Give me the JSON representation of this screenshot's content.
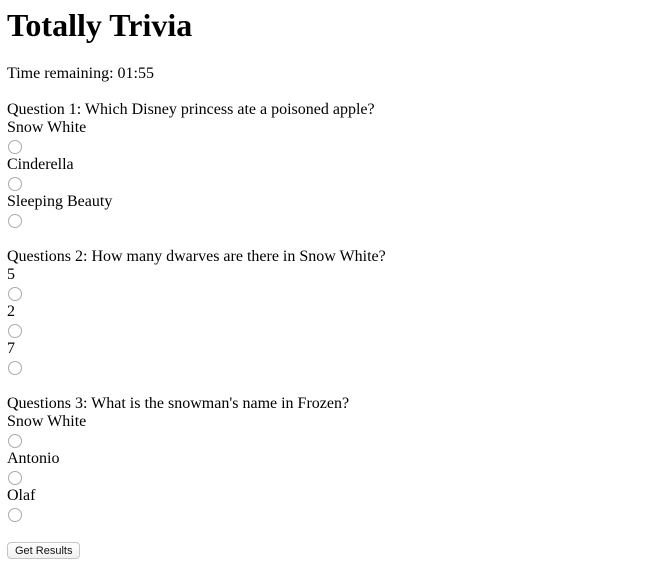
{
  "title": "Totally Trivia",
  "timer": {
    "label": "Time remaining: 01:55"
  },
  "questions": [
    {
      "text": "Question 1: Which Disney princess ate a poisoned apple?",
      "options": [
        "Snow White",
        "Cinderella",
        "Sleeping Beauty"
      ]
    },
    {
      "text": "Questions 2: How many dwarves are there in Snow White?",
      "options": [
        "5",
        "2",
        "7"
      ]
    },
    {
      "text": "Questions 3: What is the snowman's name in Frozen?",
      "options": [
        "Snow White",
        "Antonio",
        "Olaf"
      ]
    }
  ],
  "submit": {
    "label": "Get Results"
  }
}
